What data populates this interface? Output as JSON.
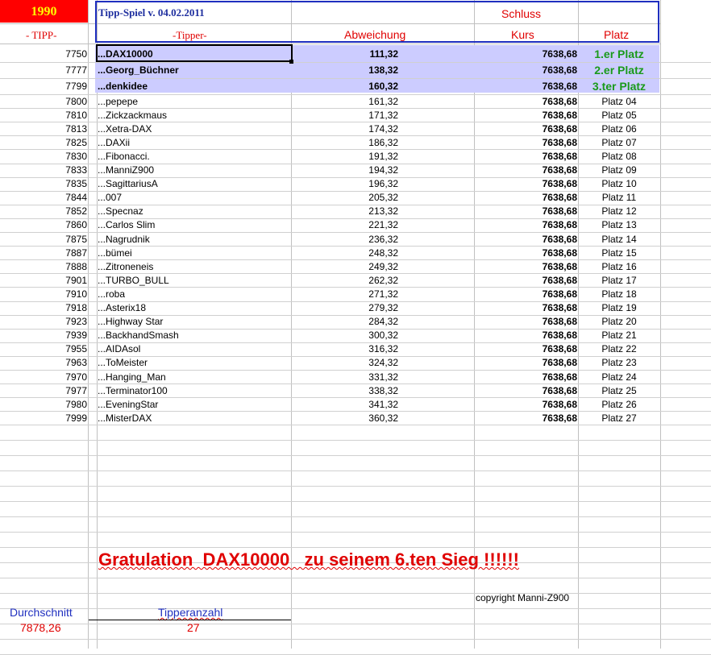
{
  "header": {
    "year": "1990",
    "title": "Tipp-Spiel v. 04.02.2011",
    "schluss": "Schluss",
    "col_tipp": "- TIPP-",
    "col_tipper": "-Tipper-",
    "col_abweichung": "Abweichung",
    "col_kurs": "Kurs",
    "col_platz": "Platz"
  },
  "rows": [
    {
      "tipp": "7750",
      "name": "...DAX10000",
      "abw": "111,32",
      "kurs": "7638,68",
      "platz": "1.er Platz"
    },
    {
      "tipp": "7777",
      "name": "...Georg_Büchner",
      "abw": "138,32",
      "kurs": "7638,68",
      "platz": "2.er Platz"
    },
    {
      "tipp": "7799",
      "name": "...denkidee",
      "abw": "160,32",
      "kurs": "7638,68",
      "platz": "3.ter Platz"
    },
    {
      "tipp": "7800",
      "name": "...pepepe",
      "abw": "161,32",
      "kurs": "7638,68",
      "platz": "Platz 04"
    },
    {
      "tipp": "7810",
      "name": "...Zickzackmaus",
      "abw": "171,32",
      "kurs": "7638,68",
      "platz": "Platz 05"
    },
    {
      "tipp": "7813",
      "name": "...Xetra-DAX",
      "abw": "174,32",
      "kurs": "7638,68",
      "platz": "Platz 06"
    },
    {
      "tipp": "7825",
      "name": "...DAXii",
      "abw": "186,32",
      "kurs": "7638,68",
      "platz": "Platz 07"
    },
    {
      "tipp": "7830",
      "name": "...Fibonacci.",
      "abw": "191,32",
      "kurs": "7638,68",
      "platz": "Platz 08"
    },
    {
      "tipp": "7833",
      "name": "...ManniZ900",
      "abw": "194,32",
      "kurs": "7638,68",
      "platz": "Platz 09"
    },
    {
      "tipp": "7835",
      "name": "...SagittariusA",
      "abw": "196,32",
      "kurs": "7638,68",
      "platz": "Platz 10"
    },
    {
      "tipp": "7844",
      "name": "...007",
      "abw": "205,32",
      "kurs": "7638,68",
      "platz": "Platz 11"
    },
    {
      "tipp": "7852",
      "name": "...Specnaz",
      "abw": "213,32",
      "kurs": "7638,68",
      "platz": "Platz 12"
    },
    {
      "tipp": "7860",
      "name": "...Carlos Slim",
      "abw": "221,32",
      "kurs": "7638,68",
      "platz": "Platz 13"
    },
    {
      "tipp": "7875",
      "name": "...Nagrudnik",
      "abw": "236,32",
      "kurs": "7638,68",
      "platz": "Platz 14"
    },
    {
      "tipp": "7887",
      "name": "...bümei",
      "abw": "248,32",
      "kurs": "7638,68",
      "platz": "Platz 15"
    },
    {
      "tipp": "7888",
      "name": "...Zitroneneis",
      "abw": "249,32",
      "kurs": "7638,68",
      "platz": "Platz 16"
    },
    {
      "tipp": "7901",
      "name": "...TURBO_BULL",
      "abw": "262,32",
      "kurs": "7638,68",
      "platz": "Platz 17"
    },
    {
      "tipp": "7910",
      "name": "...roba",
      "abw": "271,32",
      "kurs": "7638,68",
      "platz": "Platz 18"
    },
    {
      "tipp": "7918",
      "name": "...Asterix18",
      "abw": "279,32",
      "kurs": "7638,68",
      "platz": "Platz 19"
    },
    {
      "tipp": "7923",
      "name": "...Highway Star",
      "abw": "284,32",
      "kurs": "7638,68",
      "platz": "Platz 20"
    },
    {
      "tipp": "7939",
      "name": "...BackhandSmash",
      "abw": "300,32",
      "kurs": "7638,68",
      "platz": "Platz 21"
    },
    {
      "tipp": "7955",
      "name": "...AIDAsol",
      "abw": "316,32",
      "kurs": "7638,68",
      "platz": "Platz 22"
    },
    {
      "tipp": "7963",
      "name": "...ToMeister",
      "abw": "324,32",
      "kurs": "7638,68",
      "platz": "Platz 23"
    },
    {
      "tipp": "7970",
      "name": "...Hanging_Man",
      "abw": "331,32",
      "kurs": "7638,68",
      "platz": "Platz 24"
    },
    {
      "tipp": "7977",
      "name": "...Terminator100",
      "abw": "338,32",
      "kurs": "7638,68",
      "platz": "Platz 25"
    },
    {
      "tipp": "7980",
      "name": "...EveningStar",
      "abw": "341,32",
      "kurs": "7638,68",
      "platz": "Platz 26"
    },
    {
      "tipp": "7999",
      "name": "...MisterDAX",
      "abw": "360,32",
      "kurs": "7638,68",
      "platz": "Platz 27"
    }
  ],
  "congrats": "Gratulation  DAX10000   zu seinem 6.ten Sieg !!!!!!",
  "copyright": "copyright Manni-Z900",
  "footer": {
    "durchschnitt_label": "Durchschnitt",
    "durchschnitt_value": "7878,26",
    "tipperanzahl_label": "Tipperanzahl",
    "tipperanzahl_value": "27"
  },
  "colors": {
    "accent_blue": "#1f2fbf",
    "red": "#e00000",
    "highlight": "#ccccff",
    "winner_green": "#1a9a1a",
    "year_bg": "#ff0000",
    "year_text": "#ffff00"
  }
}
